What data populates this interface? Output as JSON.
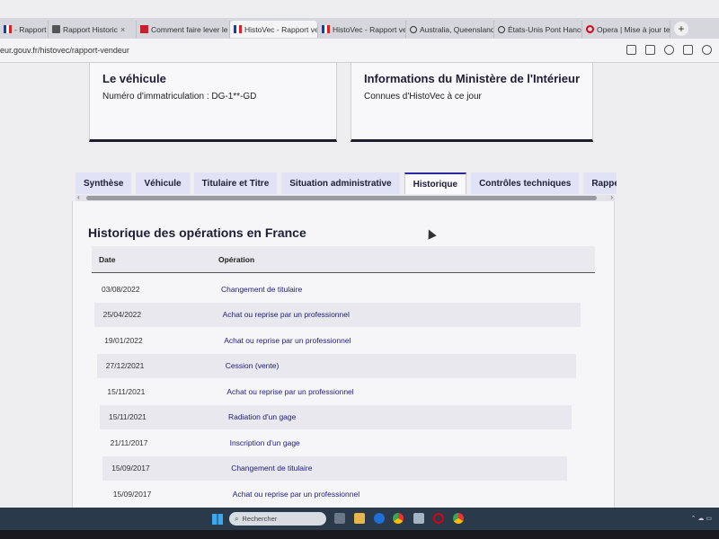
{
  "browser": {
    "tabs": [
      {
        "label": "- Rapport vende",
        "favicon": "flag",
        "active": false
      },
      {
        "label": "Rapport Historic",
        "favicon": "doc",
        "active": false
      },
      {
        "label": "Comment faire lever le ga",
        "favicon": "pdf",
        "active": false
      },
      {
        "label": "HistoVec - Rapport vende",
        "favicon": "flag",
        "active": true
      },
      {
        "label": "HistoVec - Rapport vende",
        "favicon": "flag",
        "active": false
      },
      {
        "label": "Australia, Queensland, Wh",
        "favicon": "search",
        "active": false
      },
      {
        "label": "États-Unis Pont Hancock-C",
        "favicon": "search",
        "active": false
      },
      {
        "label": "Opera | Mise à jour termi",
        "favicon": "opera",
        "active": false
      }
    ],
    "new_tab": "+",
    "url": "eur.gouv.fr/histovec/rapport-vendeur"
  },
  "cards": {
    "vehicle": {
      "title": "Le véhicule",
      "text": "Numéro d'immatriculation : DG-1**-GD"
    },
    "ministry": {
      "title": "Informations du Ministère de l'Intérieur",
      "text": "Connues d'HistoVec à ce jour"
    }
  },
  "page_tabs": [
    "Synthèse",
    "Véhicule",
    "Titulaire et Titre",
    "Situation administrative",
    "Historique",
    "Contrôles techniques",
    "Rappels constructeur"
  ],
  "active_tab": "Historique",
  "history": {
    "title": "Historique des opérations en France",
    "columns": {
      "date": "Date",
      "operation": "Opération"
    },
    "rows": [
      {
        "date": "03/08/2022",
        "operation": "Changement de titulaire"
      },
      {
        "date": "25/04/2022",
        "operation": "Achat ou reprise par un professionnel"
      },
      {
        "date": "19/01/2022",
        "operation": "Achat ou reprise par un professionnel"
      },
      {
        "date": "27/12/2021",
        "operation": "Cession (vente)"
      },
      {
        "date": "15/11/2021",
        "operation": "Achat ou reprise par un professionnel"
      },
      {
        "date": "15/11/2021",
        "operation": "Radiation d'un gage"
      },
      {
        "date": "21/11/2017",
        "operation": "Inscription d'un gage"
      },
      {
        "date": "15/09/2017",
        "operation": "Changement de titulaire"
      },
      {
        "date": "15/09/2017",
        "operation": "Achat ou reprise par un professionnel"
      }
    ]
  },
  "taskbar": {
    "search_placeholder": "Rechercher"
  },
  "colors": {
    "accent": "#1c1c7e",
    "tab_bg": "#e2e2f7",
    "taskbar": "#2b3a4a"
  }
}
